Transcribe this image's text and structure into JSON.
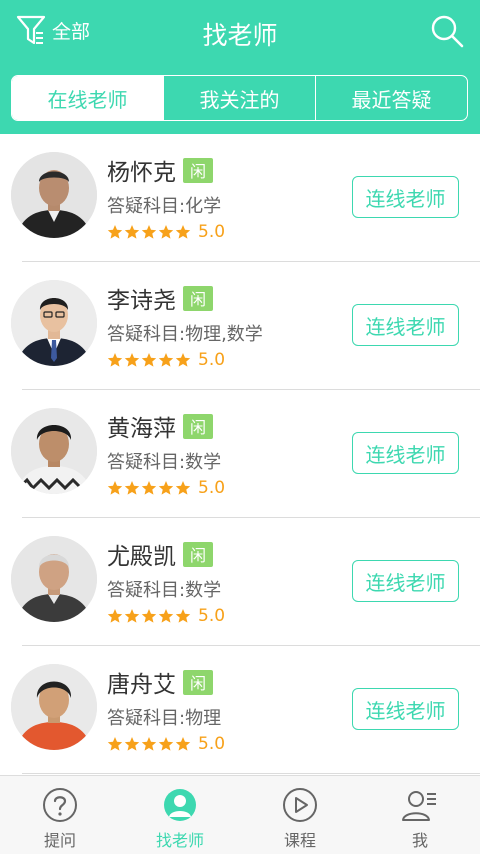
{
  "header": {
    "filter_label": "全部",
    "title": "找老师",
    "accent": "#3dd8b0"
  },
  "tabs": [
    {
      "label": "在线老师",
      "active": true
    },
    {
      "label": "我关注的",
      "active": false
    },
    {
      "label": "最近答疑",
      "active": false
    }
  ],
  "teachers": [
    {
      "name": "杨怀克",
      "status": "闲",
      "subject": "答疑科目:化学",
      "rating": "5.0",
      "stars": 5,
      "button": "连线老师"
    },
    {
      "name": "李诗尧",
      "status": "闲",
      "subject": "答疑科目:物理,数学",
      "rating": "5.0",
      "stars": 5,
      "button": "连线老师"
    },
    {
      "name": "黄海萍",
      "status": "闲",
      "subject": "答疑科目:数学",
      "rating": "5.0",
      "stars": 5,
      "button": "连线老师"
    },
    {
      "name": "尤殿凯",
      "status": "闲",
      "subject": "答疑科目:数学",
      "rating": "5.0",
      "stars": 5,
      "button": "连线老师"
    },
    {
      "name": "唐舟艾",
      "status": "闲",
      "subject": "答疑科目:物理",
      "rating": "5.0",
      "stars": 5,
      "button": "连线老师"
    }
  ],
  "bottom_nav": [
    {
      "label": "提问",
      "icon": "question-icon",
      "active": false
    },
    {
      "label": "找老师",
      "icon": "teacher-icon",
      "active": true
    },
    {
      "label": "课程",
      "icon": "play-icon",
      "active": false
    },
    {
      "label": "我",
      "icon": "profile-icon",
      "active": false
    }
  ]
}
